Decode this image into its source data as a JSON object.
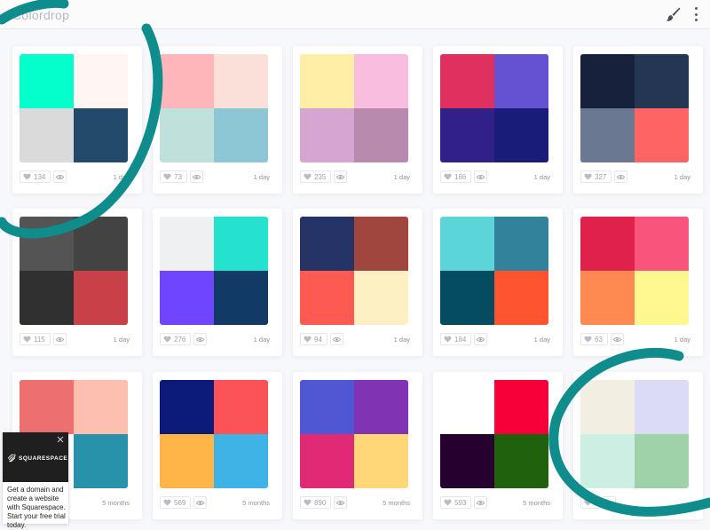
{
  "header": {
    "title": "Colordrop",
    "brush_icon": "paintbrush-icon",
    "menu_icon": "more-vertical-icon"
  },
  "palettes": [
    {
      "colors": [
        "#05ffcc",
        "#fff6f4",
        "#dadada",
        "#224a6b"
      ],
      "likes": "134",
      "age": "1 day"
    },
    {
      "colors": [
        "#ffb6bb",
        "#fbe0da",
        "#bfe0db",
        "#8dc7d5"
      ],
      "likes": "73",
      "age": "1 day"
    },
    {
      "colors": [
        "#ffeea6",
        "#f9bddf",
        "#d7a6d0",
        "#b78aae"
      ],
      "likes": "235",
      "age": "1 day"
    },
    {
      "colors": [
        "#e0305f",
        "#6452d2",
        "#302088",
        "#1a1c7a"
      ],
      "likes": "166",
      "age": "1 day"
    },
    {
      "colors": [
        "#18213c",
        "#243654",
        "#6b7891",
        "#fd6464"
      ],
      "likes": "327",
      "age": "1 day"
    },
    {
      "colors": [
        "#545454",
        "#434343",
        "#303030",
        "#c84048"
      ],
      "likes": "115",
      "age": "1 day"
    },
    {
      "colors": [
        "#eff0f1",
        "#24e2ce",
        "#6f45ff",
        "#123a66"
      ],
      "likes": "276",
      "age": "1 day"
    },
    {
      "colors": [
        "#253366",
        "#a1463f",
        "#fd5b51",
        "#fdf0c3"
      ],
      "likes": "94",
      "age": "1 day"
    },
    {
      "colors": [
        "#5cd5d9",
        "#32829b",
        "#054c61",
        "#ff542f"
      ],
      "likes": "184",
      "age": "1 day"
    },
    {
      "colors": [
        "#e0214c",
        "#f8547c",
        "#fe8a52",
        "#fff78f"
      ],
      "likes": "63",
      "age": "1 day"
    },
    {
      "colors": [
        "#ed6f6f",
        "#fdbfb0",
        "#ffffff",
        "#2992ab"
      ],
      "likes": "",
      "age": "5 months"
    },
    {
      "colors": [
        "#0c1b77",
        "#fb5358",
        "#ffb547",
        "#40b3e6"
      ],
      "likes": "569",
      "age": "5 months"
    },
    {
      "colors": [
        "#4f57d3",
        "#8033b2",
        "#e12a76",
        "#ffd778"
      ],
      "likes": "890",
      "age": "5 months"
    },
    {
      "colors": [
        "#ffffff",
        "#f7003a",
        "#26002e",
        "#20610d"
      ],
      "likes": "593",
      "age": "5 months"
    },
    {
      "colors": [
        "#f3eee2",
        "#dcdbf6",
        "#cdeee2",
        "#9ed2a8"
      ],
      "likes": "",
      "age": ""
    }
  ],
  "ad": {
    "brand": "SQUARESPACE",
    "body": "Get a domain and create a website with Squarespace. Start your free trial today."
  },
  "colors": {
    "annotation": "#0f8c8c",
    "topbar": "#fbfbfc",
    "background": "#f7f8fb"
  }
}
